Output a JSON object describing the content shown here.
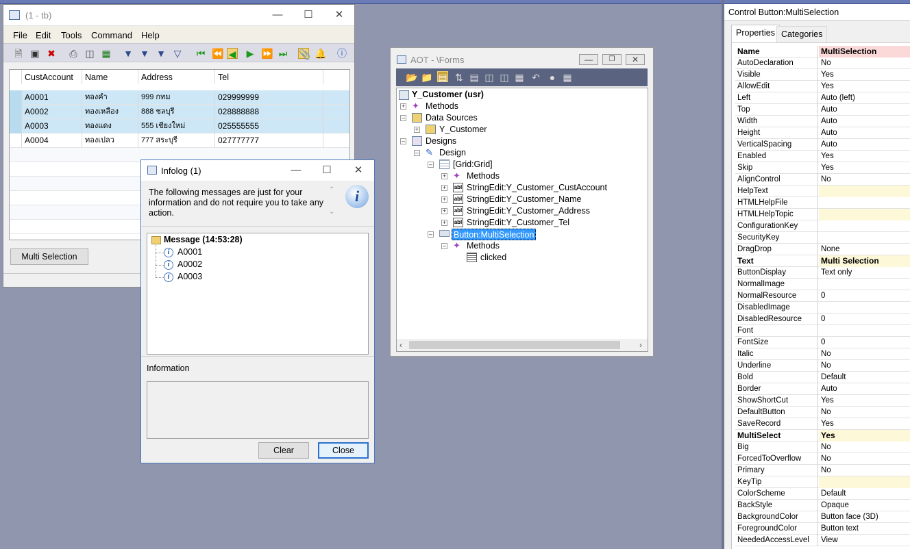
{
  "form_window": {
    "title": "(1 - tb)",
    "menu": [
      "File",
      "Edit",
      "Tools",
      "Command",
      "Help"
    ],
    "grid": {
      "columns": [
        "CustAccount",
        "Name",
        "Address",
        "Tel"
      ],
      "rows": [
        [
          "A0001",
          "ทองคำ",
          "999 กทม",
          "029999999"
        ],
        [
          "A0002",
          "ทองเหลือง",
          "888 ชลบุรี",
          "028888888"
        ],
        [
          "A0003",
          "ทองแดง",
          "555 เชียงใหม่",
          "025555555"
        ],
        [
          "A0004",
          "ทองเปลว",
          "777 สระบุรี",
          "027777777"
        ]
      ]
    },
    "multi_selection_button": "Multi Selection"
  },
  "infolog": {
    "title": "Infolog (1)",
    "message": "The following messages are just for your information and do not require you to take any action.",
    "tree": {
      "root": "Message (14:53:28)",
      "items": [
        "A0001",
        "A0002",
        "A0003"
      ]
    },
    "information_label": "Information",
    "clear_button": "Clear",
    "close_button": "Close"
  },
  "aot": {
    "title": "AOT - \\Forms",
    "nodes": [
      "Y_Customer (usr)",
      "Methods",
      "Data Sources",
      "Y_Customer",
      "Designs",
      "Design",
      "[Grid:Grid]",
      "Methods",
      "StringEdit:Y_Customer_CustAccount",
      "StringEdit:Y_Customer_Name",
      "StringEdit:Y_Customer_Address",
      "StringEdit:Y_Customer_Tel",
      "Button:MultiSelection",
      "Methods",
      "clicked"
    ]
  },
  "properties": {
    "title": "Control Button:MultiSelection",
    "tabs": [
      "Properties",
      "Categories"
    ],
    "rows": [
      [
        "Name",
        "MultiSelection"
      ],
      [
        "AutoDeclaration",
        "No"
      ],
      [
        "Visible",
        "Yes"
      ],
      [
        "AllowEdit",
        "Yes"
      ],
      [
        "Left",
        "Auto (left)"
      ],
      [
        "Top",
        "Auto"
      ],
      [
        "Width",
        "Auto"
      ],
      [
        "Height",
        "Auto"
      ],
      [
        "VerticalSpacing",
        "Auto"
      ],
      [
        "Enabled",
        "Yes"
      ],
      [
        "Skip",
        "Yes"
      ],
      [
        "AlignControl",
        "No"
      ],
      [
        "HelpText",
        ""
      ],
      [
        "HTMLHelpFile",
        ""
      ],
      [
        "HTMLHelpTopic",
        ""
      ],
      [
        "ConfigurationKey",
        ""
      ],
      [
        "SecurityKey",
        ""
      ],
      [
        "DragDrop",
        "None"
      ],
      [
        "Text",
        "Multi Selection"
      ],
      [
        "ButtonDisplay",
        "Text only"
      ],
      [
        "NormalImage",
        ""
      ],
      [
        "NormalResource",
        "0"
      ],
      [
        "DisabledImage",
        ""
      ],
      [
        "DisabledResource",
        "0"
      ],
      [
        "Font",
        ""
      ],
      [
        "FontSize",
        "0"
      ],
      [
        "Italic",
        "No"
      ],
      [
        "Underline",
        "No"
      ],
      [
        "Bold",
        "Default"
      ],
      [
        "Border",
        "Auto"
      ],
      [
        "ShowShortCut",
        "Yes"
      ],
      [
        "DefaultButton",
        "No"
      ],
      [
        "SaveRecord",
        "Yes"
      ],
      [
        "MultiSelect",
        "Yes"
      ],
      [
        "Big",
        "No"
      ],
      [
        "ForcedToOverflow",
        "No"
      ],
      [
        "Primary",
        "No"
      ],
      [
        "KeyTip",
        ""
      ],
      [
        "ColorScheme",
        "Default"
      ],
      [
        "BackStyle",
        "Opaque"
      ],
      [
        "BackgroundColor",
        "Button face (3D)"
      ],
      [
        "ForegroundColor",
        "Button text"
      ],
      [
        "NeededAccessLevel",
        "View"
      ]
    ]
  },
  "colors": {
    "desktop": "#8f96ad",
    "selection_row": "#cde7f6",
    "tree_highlight": "#3399ff",
    "name_value_bg": "#fcd9d9",
    "yellow_field": "#fdf8d8"
  }
}
